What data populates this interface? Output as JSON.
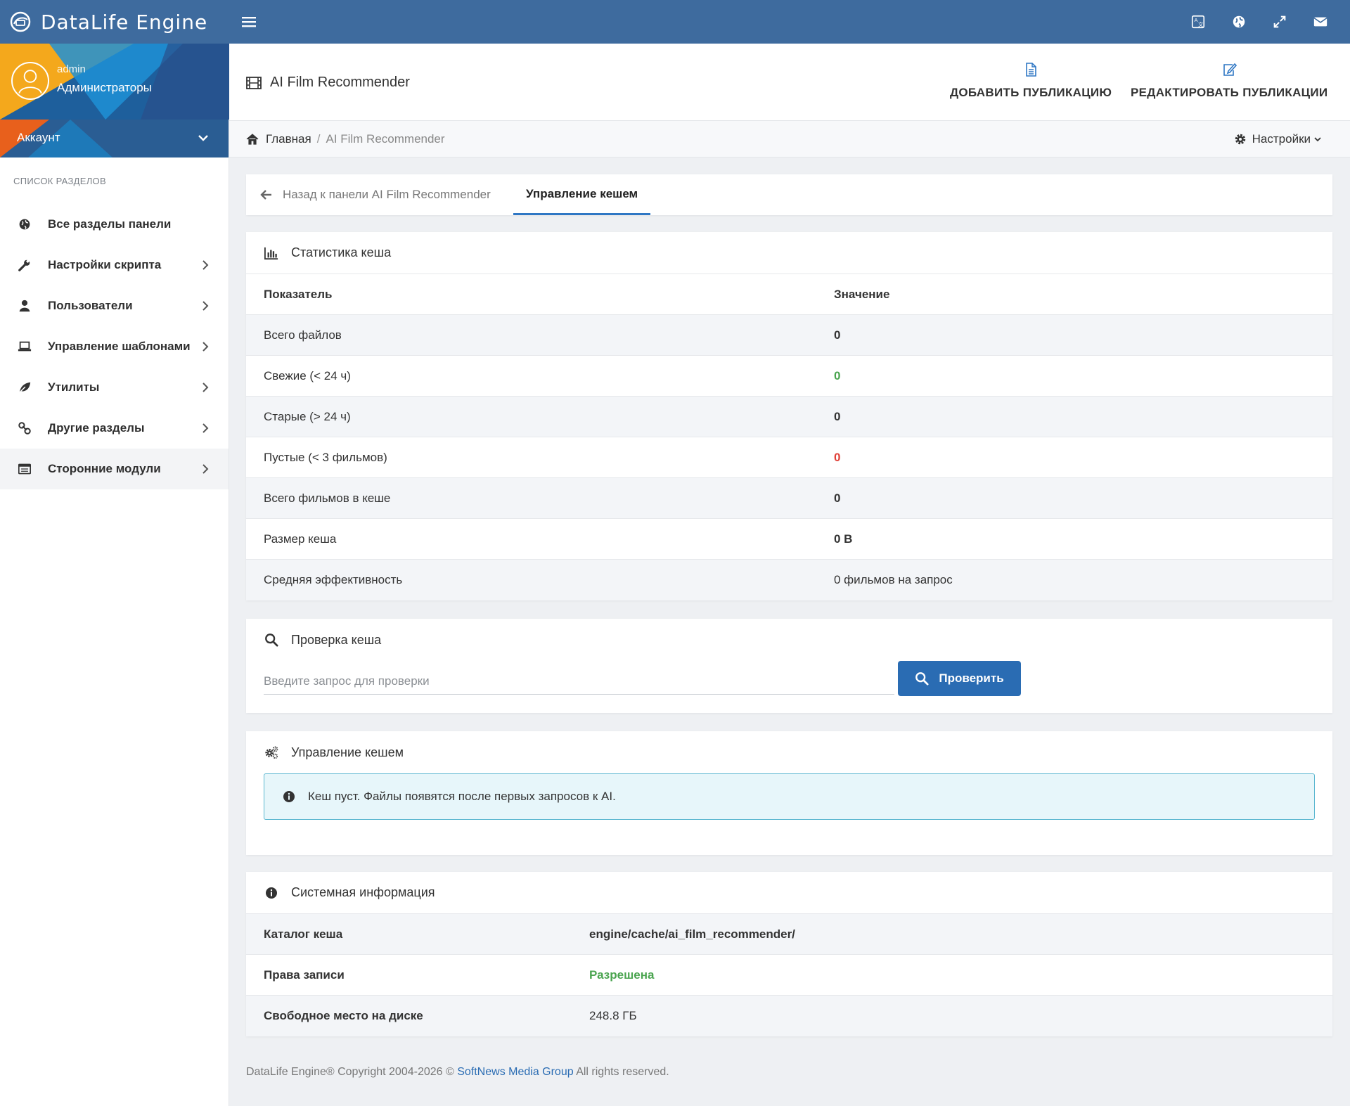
{
  "app": {
    "brand": "DataLife Engine"
  },
  "topbar": {
    "icons": [
      "language-icon",
      "globe-icon",
      "fullscreen-icon",
      "envelope-icon"
    ]
  },
  "sidebar": {
    "user": {
      "name": "admin",
      "group": "Администраторы"
    },
    "account_label": "Аккаунт",
    "section_title": "Список разделов",
    "items": [
      {
        "label": "Все разделы панели",
        "icon": "globe-icon",
        "arrow": false
      },
      {
        "label": "Настройки скрипта",
        "icon": "wrench-icon",
        "arrow": true
      },
      {
        "label": "Пользователи",
        "icon": "user-icon",
        "arrow": true
      },
      {
        "label": "Управление шаблонами",
        "icon": "laptop-icon",
        "arrow": true
      },
      {
        "label": "Утилиты",
        "icon": "leaf-icon",
        "arrow": true
      },
      {
        "label": "Другие разделы",
        "icon": "link-icon",
        "arrow": true
      },
      {
        "label": "Сторонние модули",
        "icon": "list-icon",
        "arrow": true
      }
    ]
  },
  "header": {
    "title": "AI Film Recommender",
    "add_label": "ДОБАВИТЬ ПУБЛИКАЦИЮ",
    "edit_label": "РЕДАКТИРОВАТЬ ПУБЛИКАЦИИ"
  },
  "breadcrumb": {
    "home": "Главная",
    "current": "AI Film Recommender",
    "settings": "Настройки"
  },
  "tabs": {
    "back": "Назад к панели AI Film Recommender",
    "current": "Управление кешем"
  },
  "stats": {
    "title": "Статистика кеша",
    "col_indicator": "Показатель",
    "col_value": "Значение",
    "rows": [
      {
        "label": "Всего файлов",
        "value": "0"
      },
      {
        "label": "Свежие (< 24 ч)",
        "value": "0"
      },
      {
        "label": "Старые (> 24 ч)",
        "value": "0"
      },
      {
        "label": "Пустые (< 3 фильмов)",
        "value": "0"
      },
      {
        "label": "Всего фильмов в кеше",
        "value": "0"
      },
      {
        "label": "Размер кеша",
        "value": "0 B"
      },
      {
        "label": "Средняя эффективность",
        "value": "0 фильмов на запрос"
      }
    ]
  },
  "check": {
    "title": "Проверка кеша",
    "placeholder": "Введите запрос для проверки",
    "value": "",
    "button": "Проверить"
  },
  "manage": {
    "title": "Управление кешем",
    "alert": "Кеш пуст. Файлы появятся после первых запросов к AI."
  },
  "sysinfo": {
    "title": "Системная информация",
    "rows": [
      {
        "label": "Каталог кеша",
        "value": "engine/cache/ai_film_recommender/"
      },
      {
        "label": "Права записи",
        "value": "Разрешена"
      },
      {
        "label": "Свободное место на диске",
        "value": "248.8 ГБ"
      }
    ]
  },
  "footer": {
    "prefix": "DataLife Engine® Copyright 2004-2026 ©",
    "link": "SoftNews Media Group",
    "suffix": "All rights reserved."
  },
  "colors": {
    "topbar": "#3e6b9e",
    "accent": "#2a6cb3",
    "green": "#4aa44f",
    "red": "#e04038"
  }
}
